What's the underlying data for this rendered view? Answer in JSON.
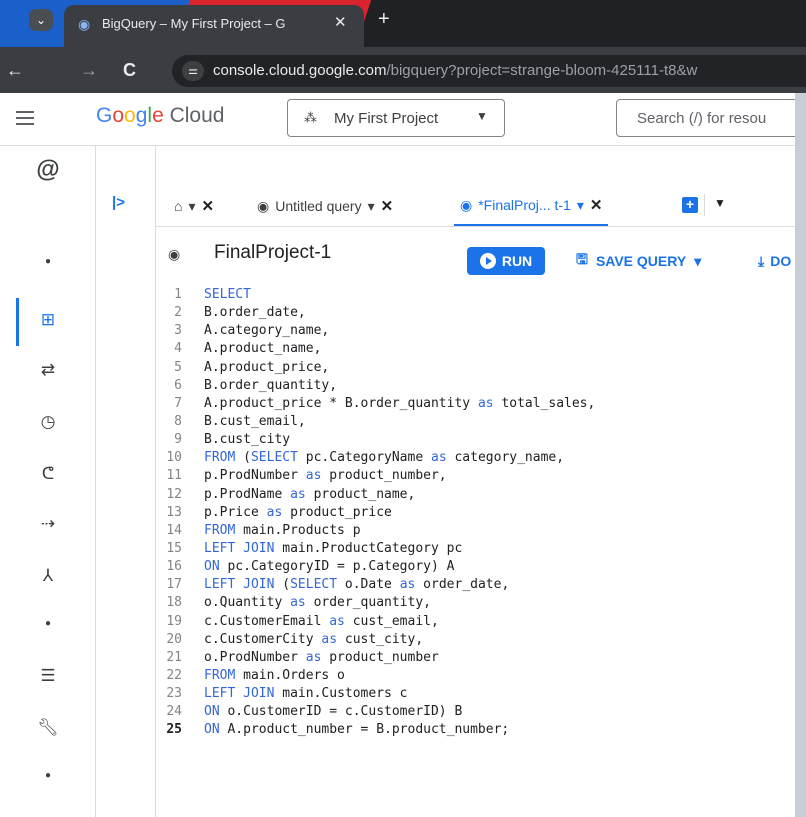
{
  "browser": {
    "tab_title": "BigQuery – My First Project – G",
    "close_glyph": "✕",
    "newtab_glyph": "+",
    "url_domain": "console.cloud.google.com",
    "url_path": "/bigquery?project=strange-bloom-425111-t8&w"
  },
  "header": {
    "logo_parts": [
      "G",
      "o",
      "o",
      "g",
      "l",
      "e"
    ],
    "logo_suffix": " Cloud",
    "project_name": "My First Project",
    "search_placeholder": "Search (/) for resou"
  },
  "query_tabs": [
    {
      "label": "",
      "icon": "home-icon"
    },
    {
      "label": "Untitled query",
      "icon": "query-icon"
    },
    {
      "label": "*FinalProj... t-1",
      "icon": "query-icon",
      "active": true
    }
  ],
  "toolbar": {
    "query_name": "FinalProject-1",
    "run_label": "RUN",
    "save_label": "SAVE QUERY",
    "download_label": "DO"
  },
  "editor": {
    "current_line": 25,
    "lines": [
      [
        {
          "t": "SELECT",
          "k": 1
        }
      ],
      [
        {
          "t": "B.order_date,"
        }
      ],
      [
        {
          "t": "A.category_name,"
        }
      ],
      [
        {
          "t": "A.product_name,"
        }
      ],
      [
        {
          "t": "A.product_price,"
        }
      ],
      [
        {
          "t": "B.order_quantity,"
        }
      ],
      [
        {
          "t": "A.product_price * B.order_quantity "
        },
        {
          "t": "as",
          "k": 1
        },
        {
          "t": " total_sales,"
        }
      ],
      [
        {
          "t": "B.cust_email,"
        }
      ],
      [
        {
          "t": "B.cust_city"
        }
      ],
      [
        {
          "t": "FROM",
          "k": 1
        },
        {
          "t": " ("
        },
        {
          "t": "SELECT",
          "k": 1
        },
        {
          "t": " pc.CategoryName "
        },
        {
          "t": "as",
          "k": 1
        },
        {
          "t": " category_name,"
        }
      ],
      [
        {
          "t": "p.ProdNumber "
        },
        {
          "t": "as",
          "k": 1
        },
        {
          "t": " product_number,"
        }
      ],
      [
        {
          "t": "p.ProdName "
        },
        {
          "t": "as",
          "k": 1
        },
        {
          "t": " product_name,"
        }
      ],
      [
        {
          "t": "p.Price "
        },
        {
          "t": "as",
          "k": 1
        },
        {
          "t": " product_price"
        }
      ],
      [
        {
          "t": "FROM",
          "k": 1
        },
        {
          "t": " main.Products p"
        }
      ],
      [
        {
          "t": "LEFT JOIN",
          "k": 1
        },
        {
          "t": " main.ProductCategory pc"
        }
      ],
      [
        {
          "t": "ON",
          "k": 1
        },
        {
          "t": " pc.CategoryID = p.Category) A"
        }
      ],
      [
        {
          "t": "LEFT JOIN",
          "k": 1
        },
        {
          "t": " ("
        },
        {
          "t": "SELECT",
          "k": 1
        },
        {
          "t": " o.Date "
        },
        {
          "t": "as",
          "k": 1
        },
        {
          "t": " order_date,"
        }
      ],
      [
        {
          "t": "o.Quantity "
        },
        {
          "t": "as",
          "k": 1
        },
        {
          "t": " order_quantity,"
        }
      ],
      [
        {
          "t": "c.CustomerEmail "
        },
        {
          "t": "as",
          "k": 1
        },
        {
          "t": " cust_email,"
        }
      ],
      [
        {
          "t": "c.CustomerCity "
        },
        {
          "t": "as",
          "k": 1
        },
        {
          "t": " cust_city,"
        }
      ],
      [
        {
          "t": "o.ProdNumber "
        },
        {
          "t": "as",
          "k": 1
        },
        {
          "t": " product_number"
        }
      ],
      [
        {
          "t": "FROM",
          "k": 1
        },
        {
          "t": " main.Orders o"
        }
      ],
      [
        {
          "t": "LEFT JOIN",
          "k": 1
        },
        {
          "t": " main.Customers c"
        }
      ],
      [
        {
          "t": "ON",
          "k": 1
        },
        {
          "t": " o.CustomerID = c.CustomerID) B"
        }
      ],
      [
        {
          "t": "ON",
          "k": 1
        },
        {
          "t": " A.product_number = B.product_number;"
        }
      ]
    ]
  },
  "colors": {
    "accent": "#1a73e8",
    "keyword": "#3367d6"
  }
}
